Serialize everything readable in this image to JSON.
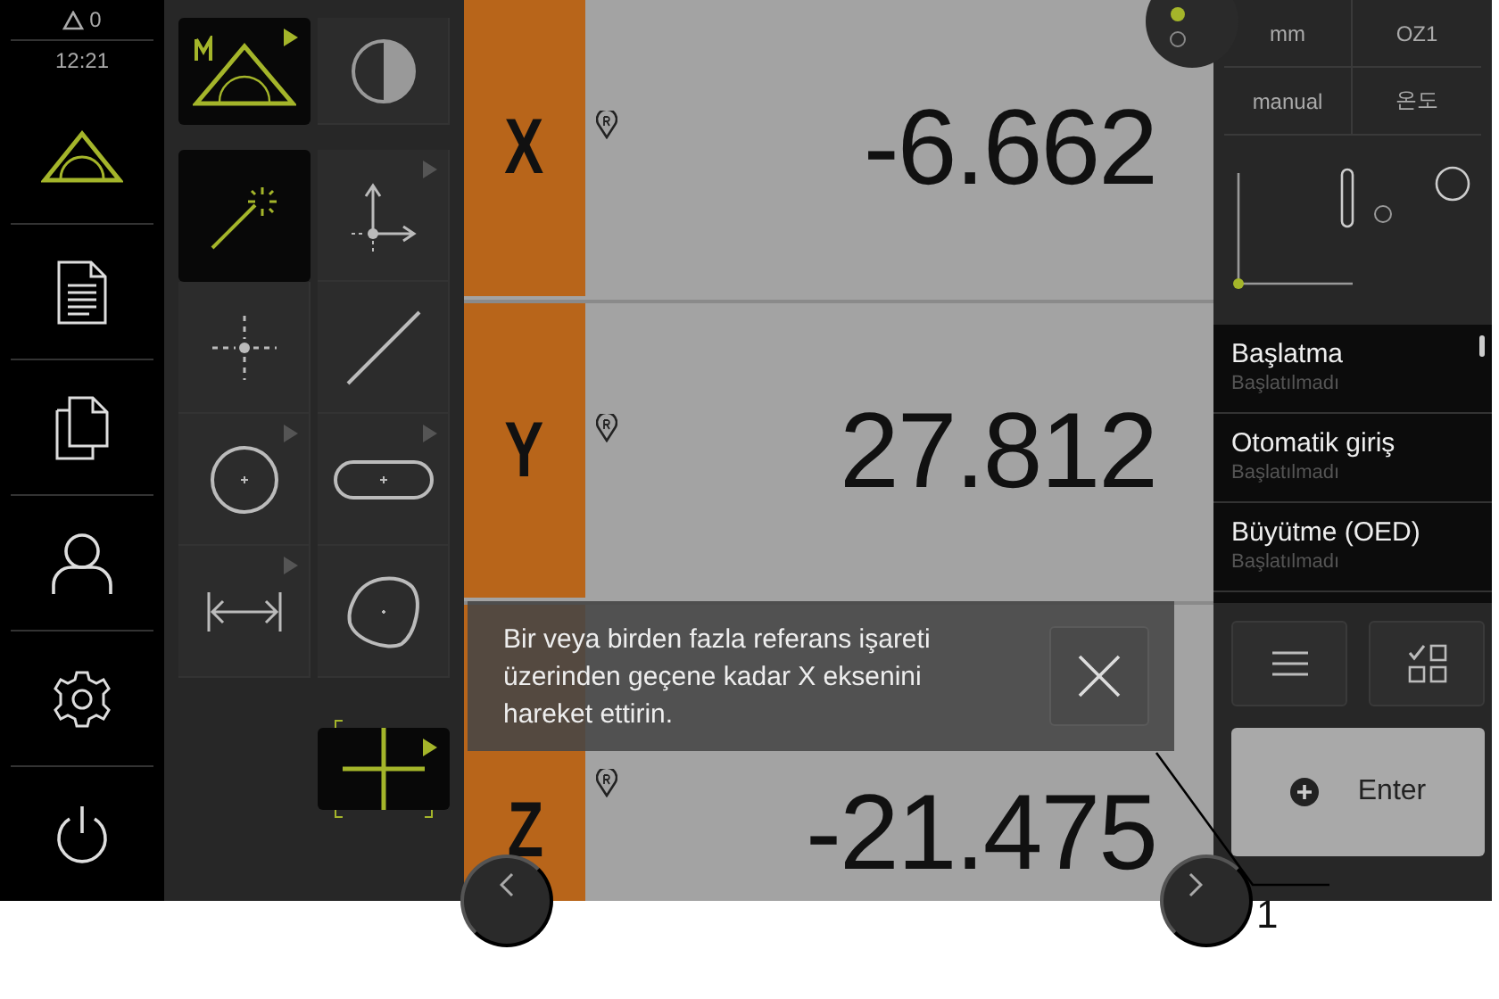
{
  "status": {
    "warnings": "0",
    "time": "12:21"
  },
  "nav": [
    {
      "kind": "measure",
      "selected": true
    },
    {
      "kind": "report",
      "selected": false
    },
    {
      "kind": "files",
      "selected": false
    },
    {
      "kind": "user",
      "selected": false
    },
    {
      "kind": "settings",
      "selected": false
    },
    {
      "kind": "power",
      "selected": false
    }
  ],
  "tools": [
    {
      "kind": "template",
      "selected": true,
      "submenu": true
    },
    {
      "kind": "contrast",
      "selected": false,
      "submenu": false
    },
    {
      "kind": "wand",
      "selected": true,
      "submenu": false
    },
    {
      "kind": "axes",
      "selected": false,
      "submenu": true
    },
    {
      "kind": "point",
      "selected": false,
      "submenu": false
    },
    {
      "kind": "line",
      "selected": false,
      "submenu": false
    },
    {
      "kind": "circle",
      "selected": false,
      "submenu": true
    },
    {
      "kind": "slot",
      "selected": false,
      "submenu": true
    },
    {
      "kind": "distance",
      "selected": false,
      "submenu": true
    },
    {
      "kind": "blob",
      "selected": false,
      "submenu": false
    },
    {
      "kind": "crosshair",
      "selected": true,
      "submenu": true
    }
  ],
  "axes": [
    {
      "label": "X",
      "value": "-6.662"
    },
    {
      "label": "Y",
      "value": "27.812"
    },
    {
      "label": "Z",
      "value": "-21.475"
    }
  ],
  "settings": [
    "mm",
    "OZ1",
    "manual",
    "온도"
  ],
  "steps": [
    {
      "title": "Başlatma",
      "status": "Başlatılmadı"
    },
    {
      "title": "Otomatik giriş",
      "status": "Başlatılmadı"
    },
    {
      "title": "Büyütme (OED)",
      "status": "Başlatılmadı"
    }
  ],
  "enter_button": "Enter",
  "message": "Bir veya birden fazla referans işareti üzerinden geçene kadar X eksenini hareket ettirin.",
  "callout": "1"
}
